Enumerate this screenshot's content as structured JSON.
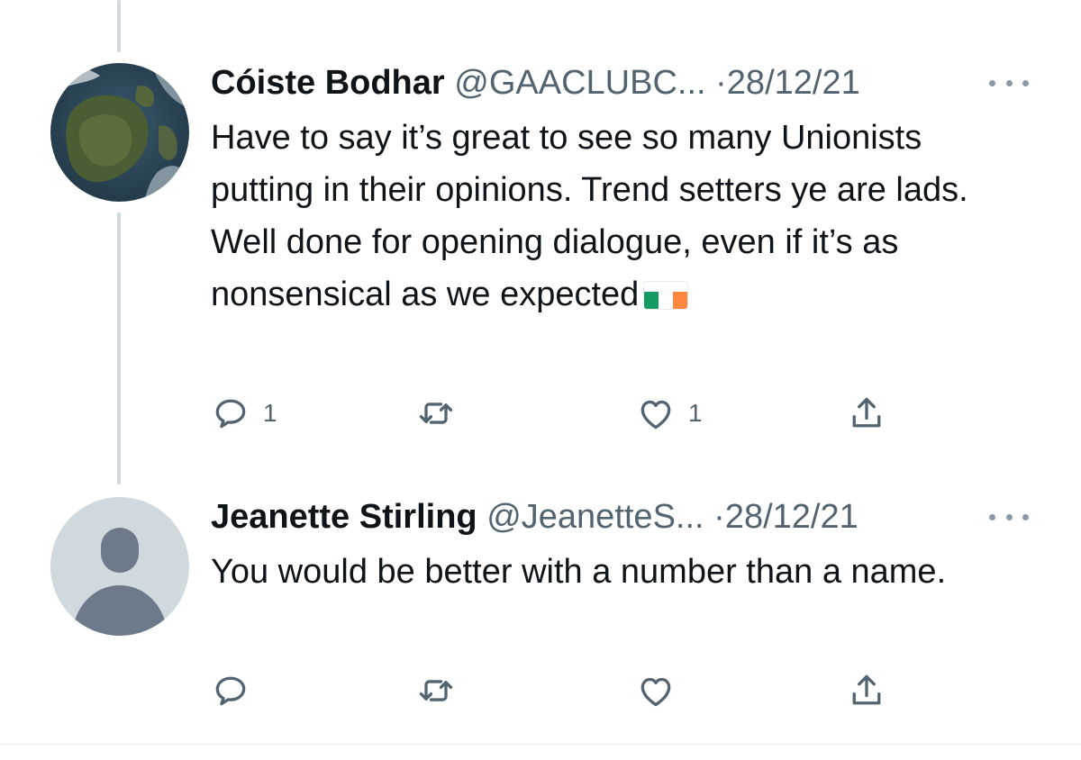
{
  "tweets": [
    {
      "display_name": "Cóiste Bodhar",
      "handle": "@GAACLUBC...",
      "dot": "·",
      "date": "28/12/21",
      "text": "Have to say it’s great to see so many Unionists putting in their opinions. Trend setters ye are lads. Well done for opening dialogue, even if it’s as nonsensical as we expected",
      "flag_colors": [
        "#169b62",
        "#ffffff",
        "#ff883e"
      ],
      "actions": {
        "reply_count": "1",
        "retweet_count": "",
        "like_count": "1"
      }
    },
    {
      "display_name": "Jeanette Stirling",
      "handle": "@JeanetteS...",
      "dot": "·",
      "date": "28/12/21",
      "text": "You would be better with a number than a name.",
      "actions": {
        "reply_count": "",
        "retweet_count": "",
        "like_count": ""
      }
    }
  ],
  "icons": [
    "reply-icon",
    "retweet-icon",
    "like-icon",
    "share-icon",
    "more-icon"
  ],
  "colors": {
    "text": "#0f1419",
    "secondary": "#536471",
    "thread_line": "#cfd9de",
    "default_avatar_bg": "#cfd9de",
    "default_avatar_fg": "#6c7a89"
  }
}
